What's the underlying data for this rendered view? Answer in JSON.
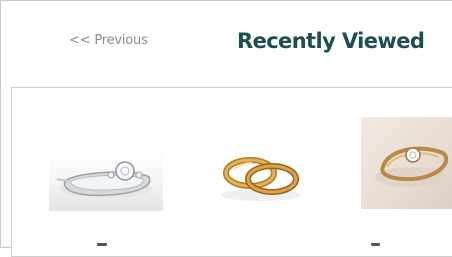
{
  "header": {
    "prev_label": "<< Previous",
    "title": "Recently Viewed"
  },
  "products": [
    {
      "icon": "engagement-ring-image",
      "accent": "#c8ccd0"
    },
    {
      "icon": "wedding-bands-image",
      "accent": "#d4a24a"
    },
    {
      "icon": "gold-diamond-ring-image",
      "accent": "#c9a36a"
    }
  ],
  "colors": {
    "title": "#1d4f52",
    "prev": "#8a8a8a",
    "border": "#cfcfcf"
  }
}
